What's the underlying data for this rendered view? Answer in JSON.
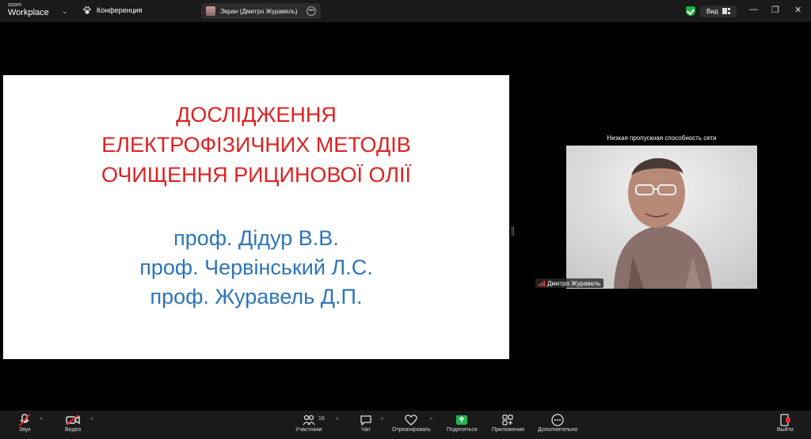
{
  "app": {
    "logo_small": "zoom",
    "logo_big": "Workplace",
    "meeting_label": "Конференция",
    "screen_share_label": "Экран (Дмитро Журавель)",
    "view_label": "Вид"
  },
  "slide": {
    "title_lines": [
      "ДОСЛІДЖЕННЯ",
      "ЕЛЕКТРОФІЗИЧНИХ МЕТОДІВ",
      "ОЧИЩЕННЯ РИЦИНОВОЇ ОЛІЇ"
    ],
    "author_lines": [
      "проф. Дідур В.В.",
      "проф. Червінський Л.С.",
      "проф. Журавель Д.П."
    ],
    "title_color": "#e02020",
    "author_color": "#2e75b6"
  },
  "participant": {
    "network_warning": "Низкая пропускная способность сети",
    "name": "Дмитро Журавель"
  },
  "toolbar": {
    "audio": "Звук",
    "video": "Видео",
    "participants": "Участники",
    "participants_count": "18",
    "chat": "Чат",
    "react": "Отреагировать",
    "share": "Поделиться",
    "apps": "Приложения",
    "more": "Дополнительно",
    "leave": "Выйти",
    "share_color": "#22b14c",
    "leave_color": "#e02828"
  }
}
